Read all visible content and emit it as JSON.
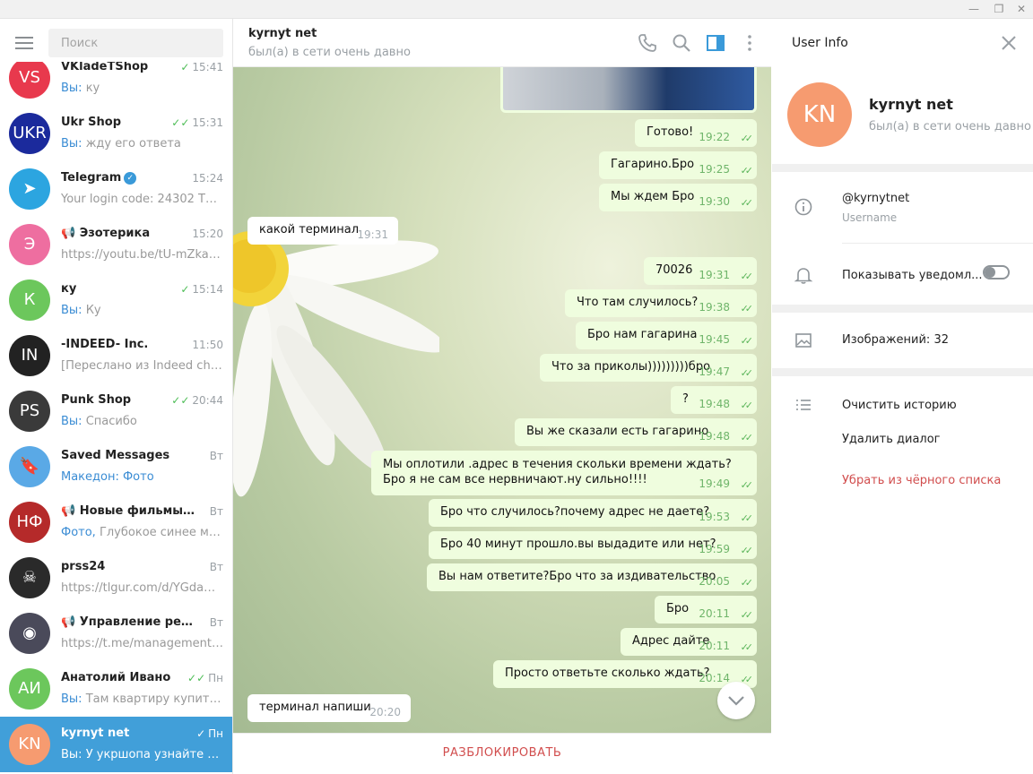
{
  "window": {
    "minimize": "—",
    "maximize": "❐",
    "close": "✕"
  },
  "search": {
    "placeholder": "Поиск"
  },
  "chats": [
    {
      "name": "VKladeTShop",
      "time": "15:41",
      "check": "✓",
      "prefix": "Вы:",
      "preview": " ку",
      "avatar_text": "VS",
      "avatar_color": "#e8394d"
    },
    {
      "name": "Ukr Shop",
      "time": "15:31",
      "check": "✓✓",
      "prefix": "Вы:",
      "preview": " жду его ответа",
      "avatar_text": "UKR",
      "avatar_color": "#1b2a9c"
    },
    {
      "name": "Telegram",
      "time": "15:24",
      "check": "",
      "prefix": "",
      "preview": "Your login code: 24302  This c...",
      "avatar_text": "➤",
      "avatar_color": "#2ca5e0"
    },
    {
      "name": "📢 Эзотерика",
      "time": "15:20",
      "check": "",
      "prefix": "",
      "preview": "https://youtu.be/tU-mZkaks...",
      "avatar_text": "Э",
      "avatar_color": "#ee6ea0"
    },
    {
      "name": "ку",
      "time": "15:14",
      "check": "✓",
      "prefix": "Вы:",
      "preview": " Ку",
      "avatar_text": "К",
      "avatar_color": "#6cc75c"
    },
    {
      "name": "-INDEED- Inc.",
      "time": "11:50",
      "check": "",
      "prefix": "",
      "preview": "[Переслано из Indeed chann...",
      "avatar_text": "IN",
      "avatar_color": "#222222"
    },
    {
      "name": "Punk Shop",
      "time": "20:44",
      "check": "✓✓",
      "prefix": "Вы:",
      "preview": " Спасибо",
      "avatar_text": "PS",
      "avatar_color": "#3a3a3a"
    },
    {
      "name": "Saved Messages",
      "time": "Вт",
      "check": "",
      "prefix": "Македон: Фото",
      "preview": "",
      "avatar_text": "🔖",
      "avatar_color": "#5aa9e6"
    },
    {
      "name": "📢 Новые фильмы он...",
      "time": "Вт",
      "check": "",
      "prefix": "Фото,",
      "preview": " Глубокое синее море...",
      "avatar_text": "НФ",
      "avatar_color": "#b52a2a"
    },
    {
      "name": "prss24",
      "time": "Вт",
      "check": "",
      "prefix": "",
      "preview": "https://tlgur.com/d/YGdaQJQg",
      "avatar_text": "☠",
      "avatar_color": "#2a2a2a"
    },
    {
      "name": "📢 Управление реальн...",
      "time": "Вт",
      "check": "",
      "prefix": "",
      "preview": "https://t.me/management_o...",
      "avatar_text": "◉",
      "avatar_color": "#4a4a5a"
    },
    {
      "name": "Анатолий Ивано",
      "time": "Пн",
      "check": "✓✓",
      "prefix": "Вы:",
      "preview": " Там квартиру купить ...",
      "avatar_text": "АИ",
      "avatar_color": "#6cc75c"
    },
    {
      "name": "kyrnyt net",
      "time": "Пн",
      "check": "✓",
      "prefix": "Вы:",
      "preview": " У укршопа узнайте я у ...",
      "avatar_text": "KN",
      "avatar_color": "#f69b70"
    }
  ],
  "peer": {
    "name": "kyrnyt net",
    "status": "был(а) в сети очень давно"
  },
  "messages": [
    {
      "text": "Готово!",
      "time": "19:22",
      "dir": "out"
    },
    {
      "text": "Гагарино.Бро",
      "time": "19:25",
      "dir": "out"
    },
    {
      "text": "Мы ждем Бро",
      "time": "19:30",
      "dir": "out"
    },
    {
      "text": "какой терминал",
      "time": "19:31",
      "dir": "in"
    },
    {
      "text": "70026",
      "time": "19:31",
      "dir": "out"
    },
    {
      "text": "Что там случилось?",
      "time": "19:38",
      "dir": "out"
    },
    {
      "text": "Бро нам гагарина",
      "time": "19:45",
      "dir": "out"
    },
    {
      "text": "Что за приколы)))))))))бро",
      "time": "19:47",
      "dir": "out"
    },
    {
      "text": "?",
      "time": "19:48",
      "dir": "out"
    },
    {
      "text": "Вы же сказали есть гагарино",
      "time": "19:48",
      "dir": "out"
    },
    {
      "text": "Мы оплотили .адрес в течения скольки времени ждать?Бро я не сам все нервничают.ну сильно!!!!",
      "time": "19:49",
      "dir": "out"
    },
    {
      "text": "Бро что случилось?почему адрес не даете?",
      "time": "19:53",
      "dir": "out"
    },
    {
      "text": "Бро 40 минут прошло.вы выдадите или нет?",
      "time": "19:59",
      "dir": "out"
    },
    {
      "text": "Вы нам ответите?Бро что за издивательство",
      "time": "20:05",
      "dir": "out"
    },
    {
      "text": "Бро",
      "time": "20:11",
      "dir": "out"
    },
    {
      "text": "Адрес дайте",
      "time": "20:11",
      "dir": "out"
    },
    {
      "text": "Просто ответьте сколько ждать?",
      "time": "20:14",
      "dir": "out"
    },
    {
      "text": "терминал напиши",
      "time": "20:20",
      "dir": "in"
    }
  ],
  "footer": {
    "unblock": "РАЗБЛОКИРОВАТЬ"
  },
  "info": {
    "title": "User Info",
    "avatar_text": "KN",
    "name": "kyrnyt net",
    "status": "был(а) в сети очень давно",
    "username": "@kyrnytnet",
    "username_label": "Username",
    "notifications": "Показывать уведомл...",
    "notifications_on": false,
    "images": "Изображений: 32",
    "clear_history": "Очистить историю",
    "delete_dialog": "Удалить диалог",
    "unblacklist": "Убрать из чёрного списка"
  },
  "colors": {
    "accent": "#419fd9",
    "danger": "#d14d4d",
    "outgoing": "#effdde"
  }
}
